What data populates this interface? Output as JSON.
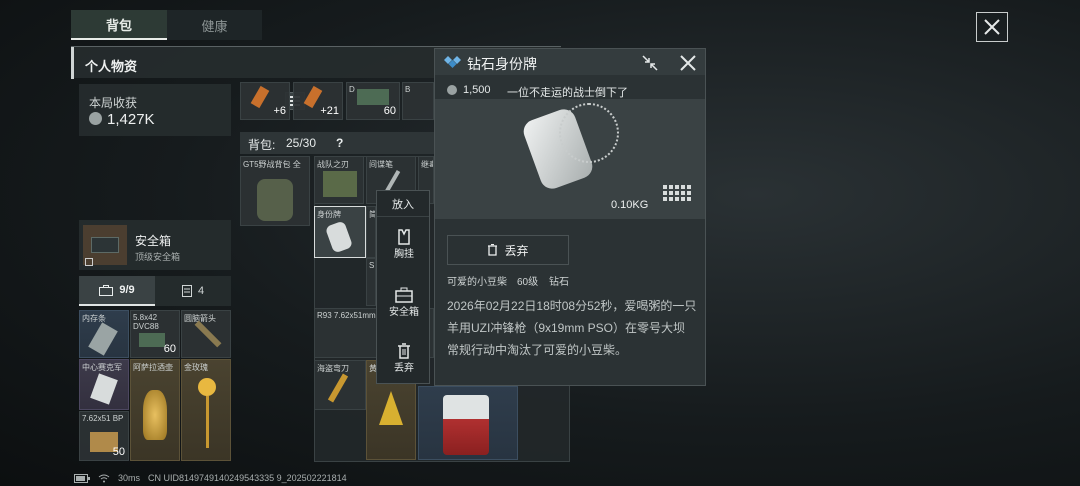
{
  "tabs": [
    {
      "label": "背包"
    },
    {
      "label": "健康"
    }
  ],
  "section": {
    "title": "个人物资"
  },
  "income": {
    "label": "本局收获",
    "value": "1,427K"
  },
  "safebox": {
    "title": "安全箱",
    "subtitle": "顶级安全箱"
  },
  "counters": {
    "slots": "9/9",
    "cards": "4"
  },
  "backpack": {
    "label": "背包:",
    "capacity": "25/30",
    "help": "?"
  },
  "top_items": [
    {
      "count": "+6"
    },
    {
      "count": "+21"
    },
    {
      "label": "D",
      "count": "60"
    },
    {
      "label": "B"
    }
  ],
  "left_items": [
    {
      "label": "内存条"
    },
    {
      "label": "5.8x42 DVC88",
      "count": "60"
    },
    {
      "label": "阿萨拉酒壶"
    },
    {
      "label": "中心赛克军"
    },
    {
      "label": "阿萨拉酒壶"
    },
    {
      "label": "金玫瑰"
    },
    {
      "label": "7.62x51 BP",
      "count": "50"
    },
    {
      "label": "圆脑箭头"
    }
  ],
  "bag_items": [
    {
      "label": "GT5野战背包 全"
    },
    {
      "label": "战队之刃"
    },
    {
      "label": "间谍笔"
    },
    {
      "label": "继毒"
    },
    {
      "label": "身份牌"
    },
    {
      "label": "简"
    },
    {
      "label": "S"
    },
    {
      "label": "R93 7.62x51mm"
    },
    {
      "label": "海盗弯刀"
    },
    {
      "label": "黄"
    }
  ],
  "context_menu": {
    "title": "放入",
    "items": [
      {
        "label": "胸挂",
        "icon": "vest-icon"
      },
      {
        "label": "安全箱",
        "icon": "safe-box-icon"
      },
      {
        "label": "丢弃",
        "icon": "trash-icon"
      }
    ]
  },
  "detail": {
    "title": "钻石身份牌",
    "price": "1,500",
    "flavor": "一位不走运的战士倒下了",
    "weight": "0.10KG",
    "discard_label": "丢弃",
    "owner": "可爱的小豆柴",
    "level": "60级",
    "rank": "钻石",
    "description": "2026年02月22日18时08分52秒，爱喝粥的一只羊用UZI冲锋枪（9x19mm PSO）在零号大坝常规行动中淘汰了可爱的小豆柴。",
    "accent": "#6fb4e6"
  },
  "status_bar": {
    "ping": "30ms",
    "uid": "CN UID8149749140249543335 9_202502221814"
  }
}
